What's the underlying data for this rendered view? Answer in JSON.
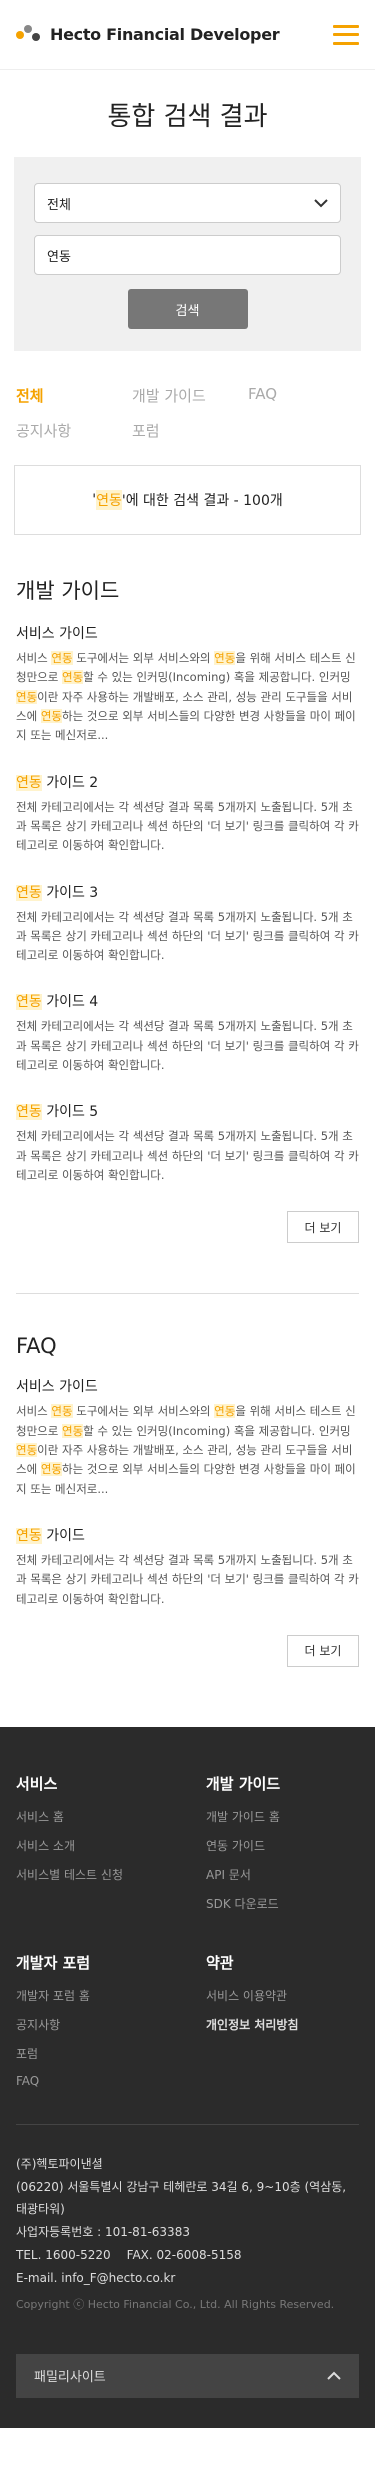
{
  "header": {
    "logo_text": "Hecto Financial Developer"
  },
  "page_title": "통합 검색 결과",
  "search": {
    "select_value": "전체",
    "input_value": "연동",
    "button_label": "검색"
  },
  "tabs": [
    {
      "label": "전체",
      "active": true
    },
    {
      "label": "개발 가이드",
      "active": false
    },
    {
      "label": "FAQ",
      "active": false
    },
    {
      "label": "공지사항",
      "active": false
    },
    {
      "label": "포럼",
      "active": false
    }
  ],
  "result_summary": {
    "open_quote": "'",
    "query": "연동",
    "suffix": "'에 대한 검색 결과 - 100개"
  },
  "keyword": "연동",
  "dev_guide": {
    "title": "개발 가이드",
    "more_label": "더 보기",
    "items": [
      {
        "title": "서비스 가이드",
        "desc": "서비스 연동 도구에서는 외부 서비스와의 연동을 위해 서비스 테스트 신청만으로 연동할 수 있는 인커밍(Incoming) 혹을 제공합니다. 인커밍 연동이란 자주 사용하는 개발배포, 소스 관리, 성능 관리 도구들을 서비스에 연동하는 것으로 외부 서비스들의 다양한 변경 사항들을 마이 페이지 또는 메신저로..."
      },
      {
        "title": "연동 가이드 2",
        "desc": "전체 카테고리에서는 각 섹션당 결과 목록 5개까지 노출됩니다. 5개 초과 목록은 상기 카테고리나 섹션 하단의 '더 보기' 링크를 클릭하여 각 카테고리로 이동하여 확인합니다."
      },
      {
        "title": "연동 가이드 3",
        "desc": "전체 카테고리에서는 각 섹션당 결과 목록 5개까지 노출됩니다. 5개 초과 목록은 상기 카테고리나 섹션 하단의 '더 보기' 링크를 클릭하여 각 카테고리로 이동하여 확인합니다."
      },
      {
        "title": "연동 가이드 4",
        "desc": "전체 카테고리에서는 각 섹션당 결과 목록 5개까지 노출됩니다. 5개 초과 목록은 상기 카테고리나 섹션 하단의 '더 보기' 링크를 클릭하여 각 카테고리로 이동하여 확인합니다."
      },
      {
        "title": "연동 가이드 5",
        "desc": "전체 카테고리에서는 각 섹션당 결과 목록 5개까지 노출됩니다. 5개 초과 목록은 상기 카테고리나 섹션 하단의 '더 보기' 링크를 클릭하여 각 카테고리로 이동하여 확인합니다."
      }
    ]
  },
  "faq": {
    "title": "FAQ",
    "more_label": "더 보기",
    "items": [
      {
        "title": "서비스 가이드",
        "desc": "서비스 연동 도구에서는 외부 서비스와의 연동을 위해 서비스 테스트 신청만으로 연동할 수 있는 인커밍(Incoming) 혹을 제공합니다. 인커밍 연동이란 자주 사용하는 개발배포, 소스 관리, 성능 관리 도구들을 서비스에 연동하는 것으로 외부 서비스들의 다양한 변경 사항들을 마이 페이지 또는 메신저로..."
      },
      {
        "title": "연동 가이드",
        "desc": "전체 카테고리에서는 각 섹션당 결과 목록 5개까지 노출됩니다. 5개 초과 목록은 상기 카테고리나 섹션 하단의 '더 보기' 링크를 클릭하여 각 카테고리로 이동하여 확인합니다."
      }
    ]
  },
  "footer": {
    "columns": [
      {
        "title": "서비스",
        "links": [
          "서비스 홈",
          "서비스 소개",
          "서비스별 테스트 신청"
        ]
      },
      {
        "title": "개발 가이드",
        "links": [
          "개발 가이드 홈",
          "연동 가이드",
          "API 문서",
          "SDK 다운로드"
        ]
      },
      {
        "title": "개발자 포럼",
        "links": [
          "개발자 포럼 홈",
          "공지사항",
          "포럼",
          "FAQ"
        ]
      },
      {
        "title": "약관",
        "links": [
          "서비스 이용약관",
          "개인정보 처리방침"
        ]
      }
    ],
    "company": {
      "name": "(주)헥토파이낸셜",
      "address": "(06220) 서울특별시 강남구 테헤란로 34길 6, 9~10층 (역삼동, 태광타워)",
      "biz_no": "사업자등록번호 : 101-81-63383",
      "tel": "TEL. 1600-5220",
      "fax": "FAX. 02-6008-5158",
      "email": "E-mail. info_F@hecto.co.kr",
      "copyright": "Copyright ⓒ Hecto Financial Co., Ltd. All Rights Reserved."
    },
    "family_site_label": "패밀리사이트"
  },
  "colors": {
    "accent": "#f5a200",
    "footer_bg": "#2b2b2b",
    "logo_dot_1": "#f5a200",
    "logo_dot_2": "#888888",
    "logo_dot_3": "#444444"
  }
}
